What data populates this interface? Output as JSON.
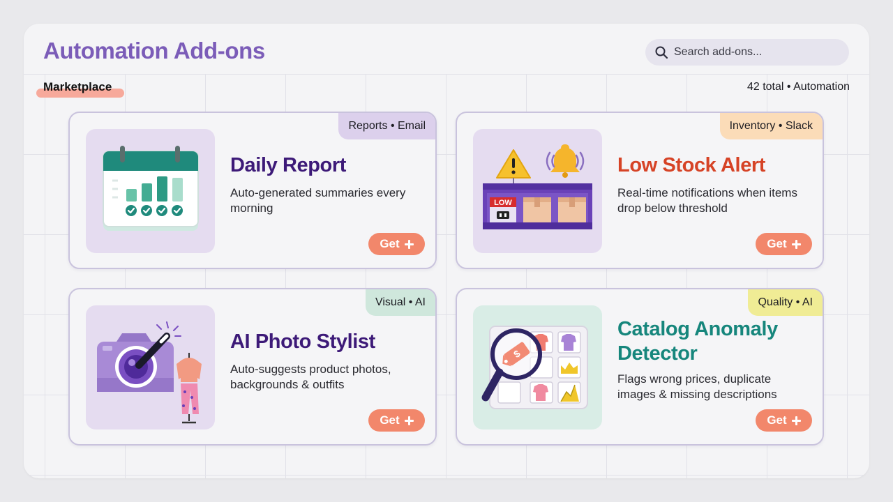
{
  "header": {
    "title": "Automation Add-ons",
    "search_placeholder": "Search add-ons..."
  },
  "subheader": {
    "section_label": "Marketplace",
    "summary": "42 total • Automation"
  },
  "colors": {
    "title": "#7b5cb8",
    "accent_button": "#f2876b",
    "card_border": "#c9c3dd"
  },
  "cards": [
    {
      "tag": "Reports • Email",
      "tag_color": "#dcd0ec",
      "title": "Daily Report",
      "title_color": "#3d1a78",
      "description": "Auto-generated summaries every morning",
      "button_label": "Get",
      "icon": "calendar-chart-icon"
    },
    {
      "tag": "Inventory • Slack",
      "tag_color": "#fbdcb8",
      "title": "Low Stock Alert",
      "title_color": "#d64326",
      "description": "Real-time notifications when items drop below threshold",
      "button_label": "Get",
      "icon": "low-stock-shelf-icon",
      "sign_text": "LOW"
    },
    {
      "tag": "Visual • AI",
      "tag_color": "#cfe7dc",
      "title": "AI Photo Stylist",
      "title_color": "#3d1a78",
      "description": "Auto-suggests product photos, backgrounds & outfits",
      "button_label": "Get",
      "icon": "camera-wand-icon"
    },
    {
      "tag": "Quality • AI",
      "tag_color": "#f0ec95",
      "title": "Catalog Anomaly Detector",
      "title_color": "#16867c",
      "description": "Flags wrong prices, duplicate images & missing descriptions",
      "button_label": "Get",
      "icon": "magnifier-catalog-icon"
    }
  ]
}
